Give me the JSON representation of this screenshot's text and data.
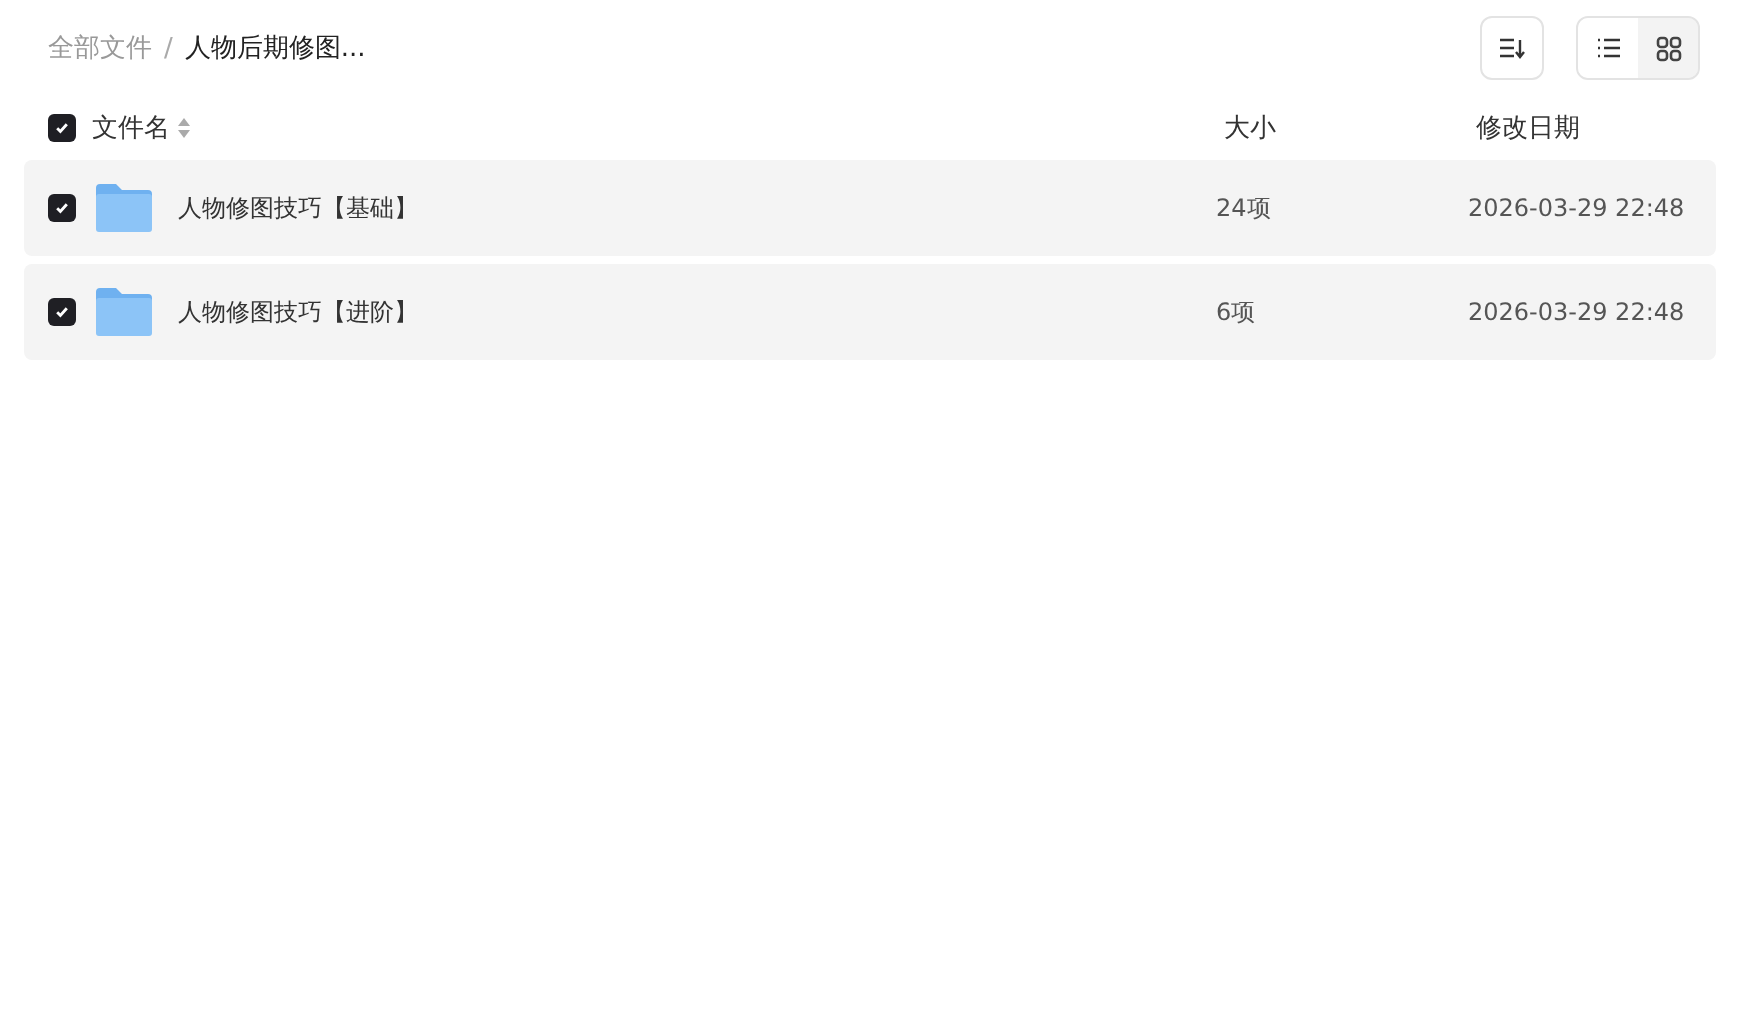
{
  "breadcrumb": [
    {
      "label": "全部文件",
      "current": false
    },
    {
      "label": "人物后期修图...",
      "current": true
    }
  ],
  "separator": "/",
  "view_modes": [
    {
      "kind": "list",
      "selected": true
    },
    {
      "kind": "grid",
      "selected": false
    }
  ],
  "header": {
    "checked": true,
    "name": "文件名",
    "size": "大小",
    "date": "修改日期"
  },
  "rows": [
    {
      "checked": true,
      "name": "人物修图技巧【基础】",
      "size": "24项",
      "date": "2026-03-29 22:48"
    },
    {
      "checked": true,
      "name": "人物修图技巧【进阶】",
      "size": "6项",
      "date": "2026-03-29 22:48"
    }
  ]
}
